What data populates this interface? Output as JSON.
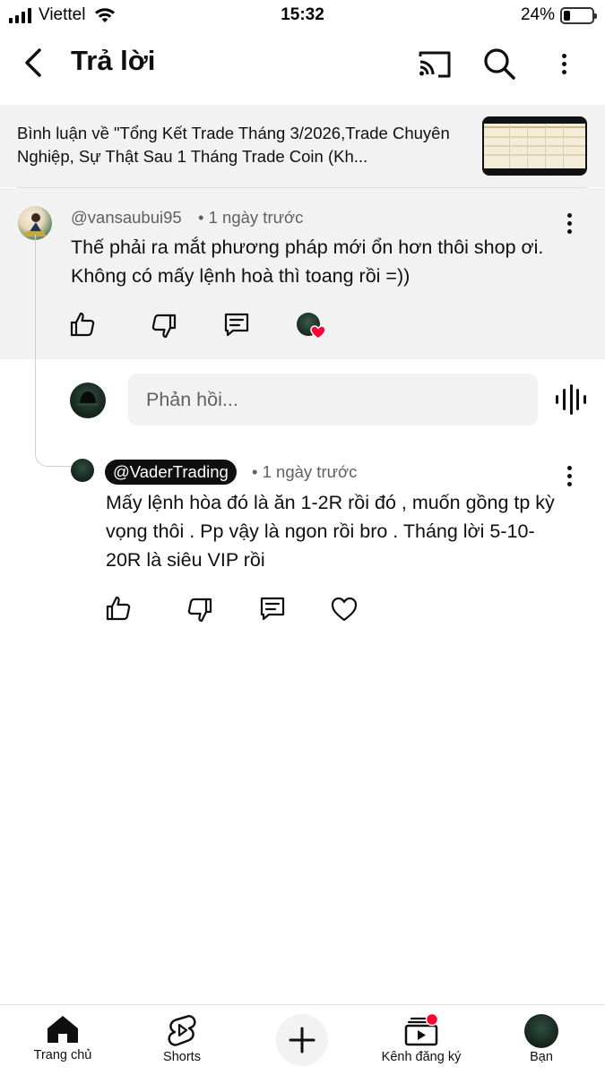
{
  "status_bar": {
    "carrier": "Viettel",
    "time": "15:32",
    "battery_percent": "24%",
    "battery_level": 0.24
  },
  "header": {
    "title": "Trả lời",
    "icons": [
      "back-arrow-icon",
      "cast-icon",
      "search-icon",
      "more-vertical-icon"
    ]
  },
  "video_context": {
    "text": "Bình luận về \"Tổng Kết Trade Tháng 3/2026,Trade Chuyên Nghiệp, Sự Thật Sau 1 Tháng Trade Coin (Kh..."
  },
  "parent_comment": {
    "username": "@vansaubui95",
    "meta": "• 1 ngày trước",
    "text": "Thế phải ra mắt phương pháp mới ổn hơn thôi shop ơi. Không có mấy lệnh hoà thì toang rồi =))",
    "actions": [
      "like-icon",
      "dislike-icon",
      "reply-icon",
      "creator-heart-avatar"
    ]
  },
  "reply_box": {
    "placeholder": "Phản hồi..."
  },
  "reply_comment": {
    "username": "@VaderTrading",
    "meta": "• 1 ngày trước",
    "text": "Mấy lệnh hòa đó là ăn 1-2R rồi đó , muốn gồng tp kỳ vọng thôi . Pp vậy là ngon rồi bro . Tháng lời 5-10-20R là siêu VIP rồi",
    "actions": [
      "like-icon",
      "dislike-icon",
      "reply-icon",
      "heart-icon"
    ]
  },
  "bottom_nav": {
    "home": "Trang chủ",
    "shorts": "Shorts",
    "subscriptions": "Kênh đăng ký",
    "you": "Bạn"
  },
  "colors": {
    "text_primary": "#0f0f0f",
    "text_secondary": "#606060",
    "surface_gray": "#f2f2f2",
    "notification_red": "#ff0033"
  }
}
